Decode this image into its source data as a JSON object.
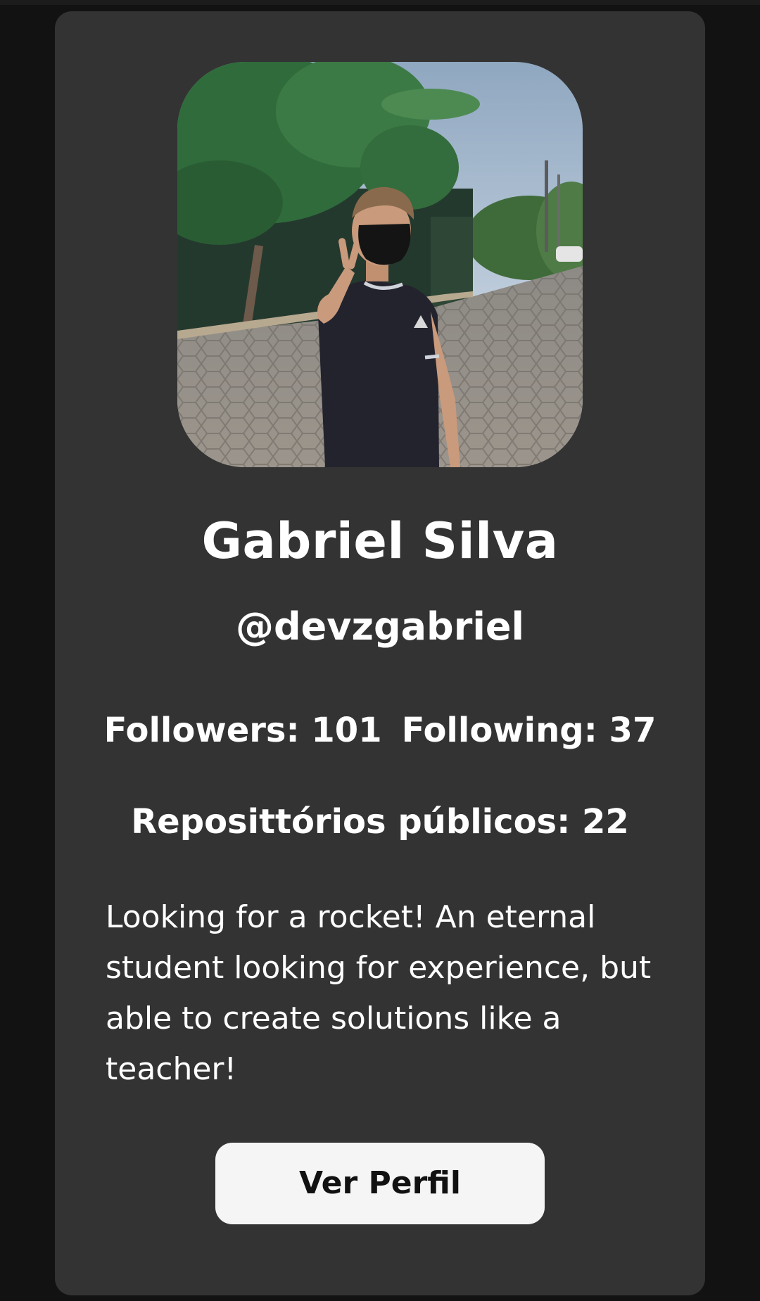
{
  "profile": {
    "name": "Gabriel Silva",
    "handle": "@devzgabriel",
    "followers_text": "Followers: 101",
    "following_text": "Following: 37",
    "repos_text": "Reposittórios públicos: 22",
    "bio": "Looking for a rocket! An eternal student looking for experience, but able to create solutions like a teacher!",
    "button_label": "Ver Perfil"
  },
  "colors": {
    "page_background": "#121212",
    "card_background": "#333333",
    "text": "#ffffff",
    "button_background": "#f5f5f5",
    "button_text": "#111111"
  }
}
